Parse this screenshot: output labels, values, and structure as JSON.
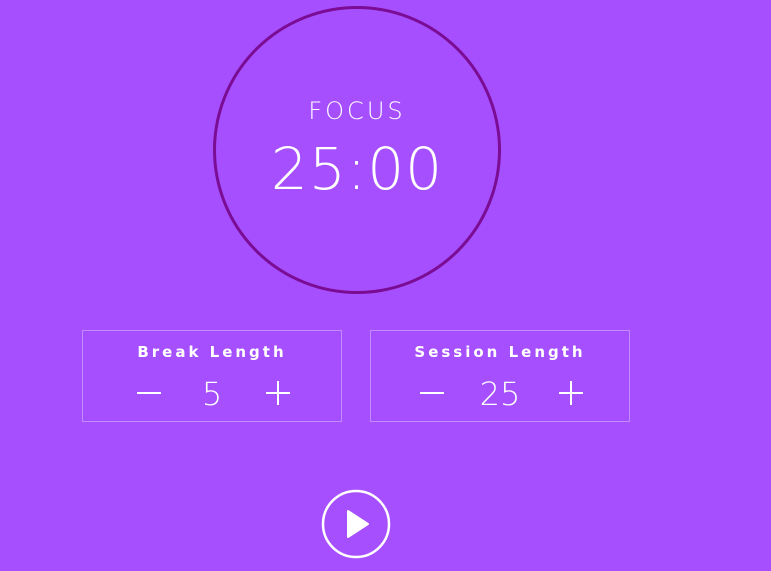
{
  "timer": {
    "label": "FOCUS",
    "time": "25:00"
  },
  "break": {
    "title": "Break Length",
    "value": "5",
    "decrement_icon": "minus-icon",
    "increment_icon": "plus-icon"
  },
  "session": {
    "title": "Session Length",
    "value": "25",
    "decrement_icon": "minus-icon",
    "increment_icon": "plus-icon"
  },
  "controls": {
    "play_icon": "play-icon"
  },
  "colors": {
    "background": "#a64fff",
    "ring": "#7a0d93",
    "text": "#ffffff"
  }
}
